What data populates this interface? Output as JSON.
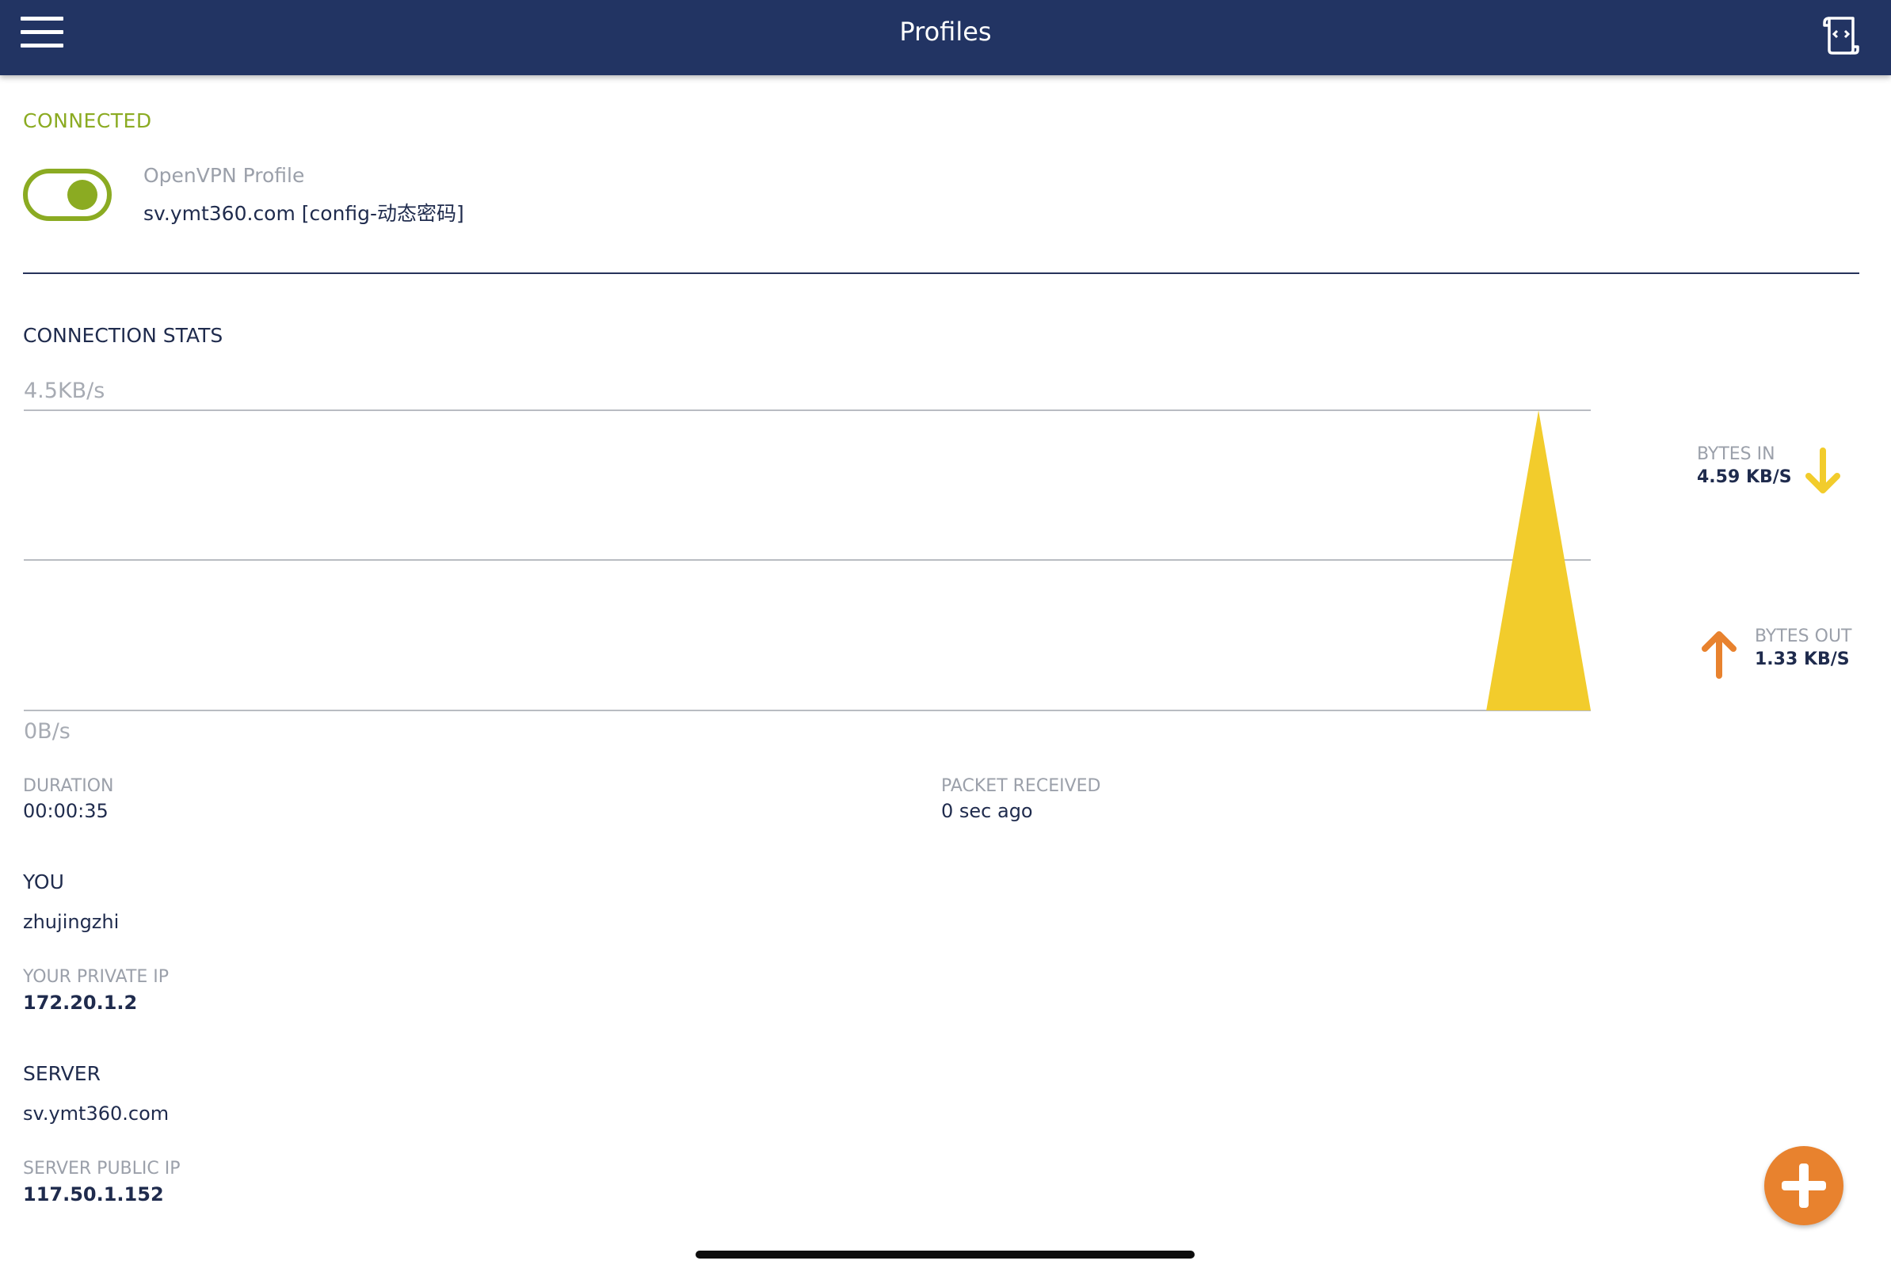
{
  "header": {
    "title": "Profiles",
    "menu_icon": "hamburger-menu-icon",
    "log_icon": "log-scroll-icon"
  },
  "connection": {
    "status": "CONNECTED",
    "toggle_on": true,
    "profile_type": "OpenVPN Profile",
    "profile_name": "sv.ymt360.com [config-动态密码]"
  },
  "stats": {
    "title": "CONNECTION STATS",
    "bytes_in": {
      "label": "BYTES IN",
      "value": "4.59 KB/S",
      "icon": "arrow-down-icon"
    },
    "bytes_out": {
      "label": "BYTES OUT",
      "value": "1.33 KB/S",
      "icon": "arrow-up-icon"
    },
    "duration": {
      "label": "DURATION",
      "value": "00:00:35"
    },
    "packet_received": {
      "label": "PACKET RECEIVED",
      "value": "0 sec ago"
    }
  },
  "you": {
    "title": "YOU",
    "username": "zhujingzhi",
    "private_ip_label": "YOUR PRIVATE IP",
    "private_ip": "172.20.1.2"
  },
  "server": {
    "title": "SERVER",
    "hostname": "sv.ymt360.com",
    "public_ip_label": "SERVER PUBLIC IP",
    "public_ip": "117.50.1.152"
  },
  "fab": {
    "icon": "plus-icon"
  },
  "colors": {
    "header_bg": "#223463",
    "connected_green": "#8bab22",
    "bytes_in": "#f2cc2c",
    "bytes_out": "#e8822e"
  },
  "chart_data": {
    "type": "area",
    "ylabel_top": "4.5KB/s",
    "ylabel_bottom": "0B/s",
    "ylim": [
      0,
      4.5
    ],
    "grid": true,
    "series": [
      {
        "name": "BYTES IN",
        "x": [
          0,
          28,
          29,
          30
        ],
        "values": [
          0,
          0,
          4.5,
          0
        ]
      }
    ]
  }
}
